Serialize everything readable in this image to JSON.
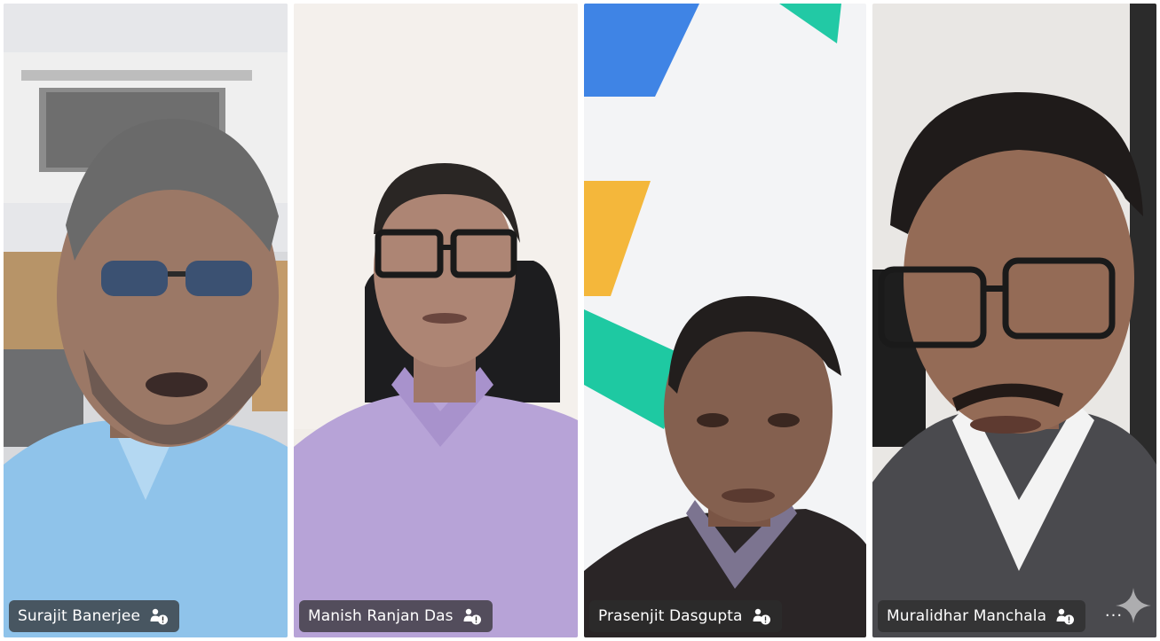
{
  "participants": [
    {
      "name": "Surajit Banerjee"
    },
    {
      "name": "Manish Ranjan Das"
    },
    {
      "name": "Prasenjit Dasgupta"
    },
    {
      "name": "Muralidhar Manchala"
    }
  ],
  "more_options_label": "···",
  "icons": {
    "mic_status": "person-with-speaker-icon",
    "more": "more-options-icon",
    "watermark": "sparkle-icon"
  }
}
